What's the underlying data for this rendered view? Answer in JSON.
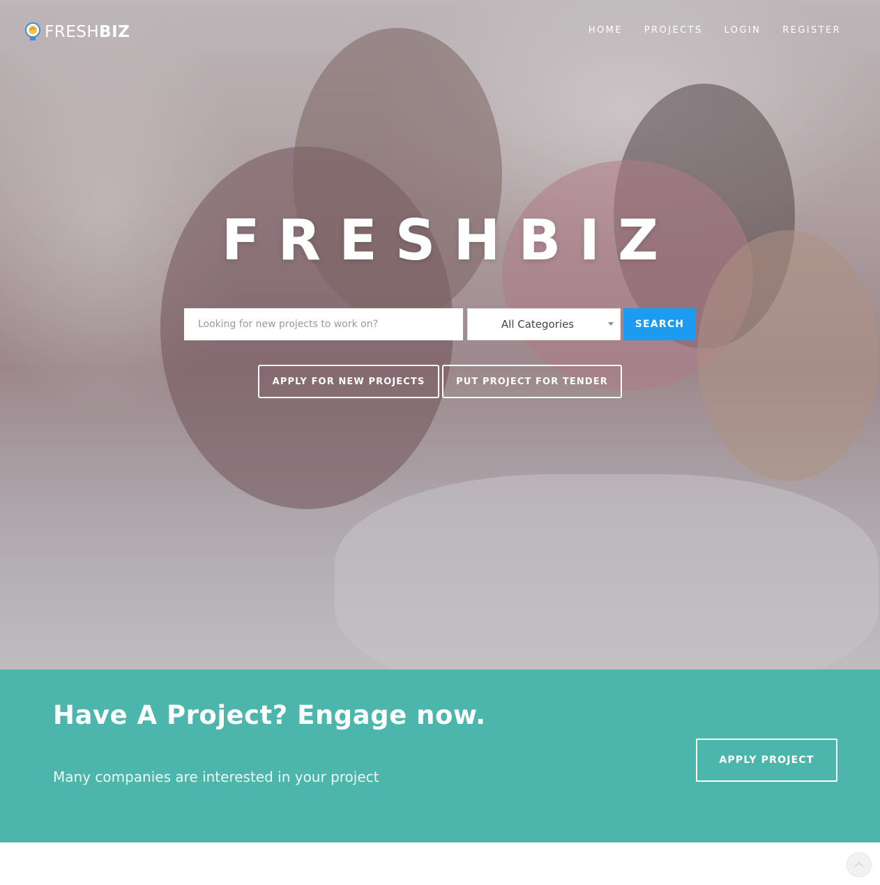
{
  "brand": {
    "logo_light": "FRESH",
    "logo_bold": "BIZ",
    "logo_icon": "lightbulb-icon"
  },
  "nav": {
    "items": [
      "HOME",
      "PROJECTS",
      "LOGIN",
      "REGISTER"
    ]
  },
  "hero": {
    "title": "FRESHBIZ",
    "search": {
      "placeholder": "Looking for new projects to work on?",
      "category_selected": "All Categories",
      "button": "SEARCH"
    },
    "buttons": {
      "apply_new": "APPLY FOR NEW PROJECTS",
      "tender": "PUT PROJECT FOR TENDER"
    }
  },
  "cta": {
    "title": "Have A Project? Engage now.",
    "subtitle": "Many companies are interested in your project",
    "button": "APPLY PROJECT"
  },
  "scroll_top": {
    "icon": "chevron-up-icon"
  },
  "colors": {
    "accent_blue": "#1d9bf0",
    "teal": "#4db6ac",
    "white": "#ffffff"
  }
}
